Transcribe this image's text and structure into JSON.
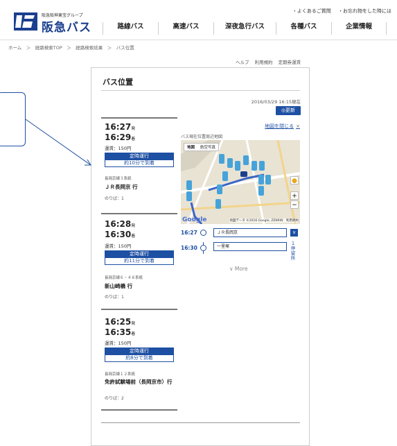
{
  "header": {
    "group_label": "阪急阪神東宝グループ",
    "logo_name": "阪急バス",
    "top_links": [
      "・よくあるご質問",
      "・お忘れ物をした時には"
    ],
    "nav": [
      "路線バス",
      "高速バス",
      "深夜急行バス",
      "各種バス",
      "企業情報"
    ]
  },
  "breadcrumb": "ホーム　＞　経路検索TOP　＞　経路検索結果　＞　バス位置",
  "utility_links": [
    "ヘルプ",
    "利用規約",
    "定期券運賃"
  ],
  "page": {
    "title": "バス位置",
    "timestamp": "2016/03/29 16:15現在",
    "refresh_label": "◎更新"
  },
  "buses": [
    {
      "dep": "16:27",
      "dep_suffix": "発",
      "arr": "16:29",
      "arr_suffix": "着",
      "fare": "運賃：150円",
      "status": "定時運行",
      "eta": "約10分で到着",
      "route": "長岡京線３系統",
      "dest": "ＪＲ長岡京 行",
      "stop": "のりば：1"
    },
    {
      "dep": "16:28",
      "dep_suffix": "発",
      "arr": "16:30",
      "arr_suffix": "着",
      "fare": "運賃：150円",
      "status": "定時運行",
      "eta": "約11分で到着",
      "route": "長岡京線６・４８系統",
      "dest": "新山崎橋 行",
      "stop": "のりば：1"
    },
    {
      "dep": "16:25",
      "dep_suffix": "発",
      "arr": "16:35",
      "arr_suffix": "着",
      "fare": "運賃：150円",
      "status": "定時運行",
      "eta": "約8分で到着",
      "route": "長岡京線１２系統",
      "dest": "免許試験場前（長岡京市）行",
      "stop": "のりば：2"
    }
  ],
  "map": {
    "close_label": "地図を閉じる",
    "close_x": "×",
    "title": "バス現在位置周辺地図",
    "tab_map": "地図",
    "tab_satellite": "航空写真",
    "google": "Google",
    "credit": "地図データ ©2016 Google, ZENRIN　利用規約",
    "zoom_in": "+",
    "zoom_out": "−"
  },
  "timeline": {
    "t1": "16:27",
    "t2": "16:30",
    "stop1": "ＪＲ長岡京",
    "stop2": "一里塚",
    "chevron": "∨",
    "vertical_text": "１停留所"
  },
  "more_label": "∨  More"
}
